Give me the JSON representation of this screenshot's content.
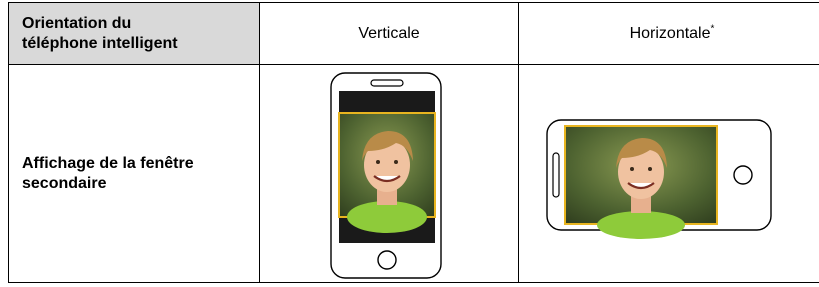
{
  "table": {
    "header": {
      "row_label": "Orientation du téléphone intelligent",
      "row_label_line1": "Orientation du",
      "row_label_line2": "téléphone intelligent",
      "col_vertical": "Verticale",
      "col_horizontal": "Horizontale",
      "footnote_mark": "*"
    },
    "row": {
      "label_line1": "Affichage de la fenêtre",
      "label_line2": "secondaire"
    }
  },
  "colors": {
    "header_bg": "#d9d9d9",
    "border": "#000000",
    "frame_accent": "#e8b520",
    "screen_bar": "#1a1a1a"
  },
  "icons": [
    "phone-vertical-icon",
    "phone-horizontal-icon",
    "home-button-icon",
    "speaker-slot-icon"
  ]
}
